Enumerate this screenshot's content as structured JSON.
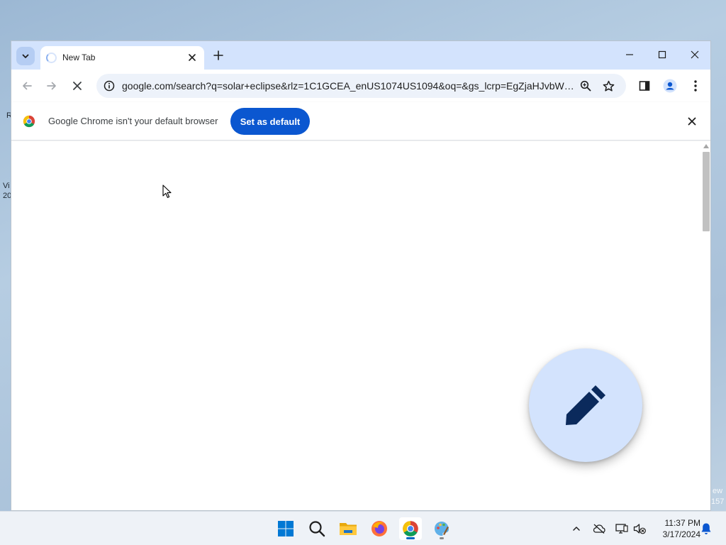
{
  "desktop": {
    "peek_left_1": "R",
    "peek_left_2": "Vi",
    "peek_left_3": "20",
    "peek_right_1": "ew",
    "peek_right_2": "157"
  },
  "browser": {
    "tab": {
      "title": "New Tab",
      "loading": true
    },
    "window_controls": [
      "minimize",
      "maximize",
      "close"
    ],
    "address_bar": {
      "url": "google.com/search?q=solar+eclipse&rlz=1C1GCEA_enUS1074US1094&oq=&gs_lcrp=EgZjaHJvbWUq..."
    },
    "infobar": {
      "message": "Google Chrome isn't your default browser",
      "button_label": "Set as default"
    },
    "fab_icon": "pencil-icon"
  },
  "taskbar": {
    "apps": [
      "start",
      "search",
      "file-explorer",
      "firefox",
      "chrome",
      "paint"
    ],
    "active_app": "chrome",
    "clock": {
      "time": "11:37 PM",
      "date": "3/17/2024"
    }
  },
  "colors": {
    "tab_strip": "#d3e3fd",
    "omnibox": "#edf2fa",
    "primary_button": "#0b57d0",
    "fab": "#d3e3fd",
    "fab_icon": "#0b2a5c"
  }
}
